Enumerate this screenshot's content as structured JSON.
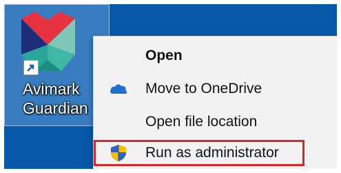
{
  "desktop": {
    "background_color": "#0758a8",
    "icon": {
      "label_lines": [
        "Avimark",
        "Guardian"
      ],
      "logo_icon": "avimark-guardian-logo-icon",
      "shortcut_icon": "shortcut-arrow-icon"
    }
  },
  "context_menu": {
    "items": [
      {
        "label": "Open",
        "bold": true,
        "icon": ""
      },
      {
        "label": "Move to OneDrive",
        "bold": false,
        "icon": "onedrive-cloud-icon"
      },
      {
        "label": "Open file location",
        "bold": false,
        "icon": ""
      },
      {
        "label": "Run as administrator",
        "bold": false,
        "icon": "uac-shield-icon",
        "highlighted": true
      }
    ],
    "highlight_color": "#d62828"
  }
}
